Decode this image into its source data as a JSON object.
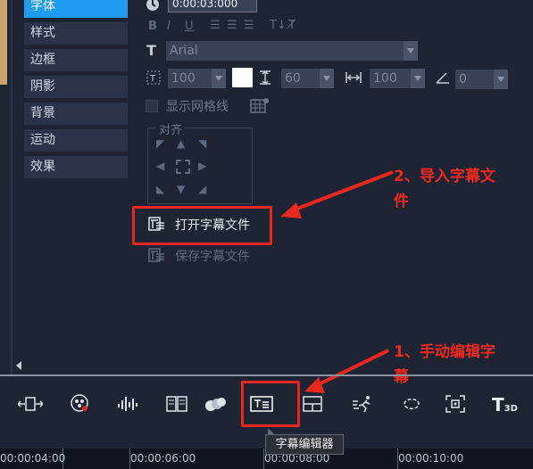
{
  "categories": [
    {
      "label": "字体",
      "active": true
    },
    {
      "label": "样式",
      "active": false
    },
    {
      "label": "边框",
      "active": false
    },
    {
      "label": "阴影",
      "active": false
    },
    {
      "label": "背景",
      "active": false
    },
    {
      "label": "运动",
      "active": false
    },
    {
      "label": "效果",
      "active": false
    }
  ],
  "duration": "0:00:03:000",
  "font": {
    "family": "Arial",
    "size": "100",
    "line_spacing": "60",
    "char_spacing": "100",
    "rotation": "0"
  },
  "show_grid_label": "显示网格线",
  "align_label": "对齐",
  "open_subtitle_label": "打开字幕文件",
  "save_subtitle_label": "保存字幕文件",
  "annotation_import": [
    "2、导入字幕文",
    "件"
  ],
  "annotation_manual": [
    "1、手动编辑字",
    "幕"
  ],
  "tooltip": "字幕编辑器",
  "timeline": [
    "00:00:04:00",
    "00:00:06:00",
    "00:00:08:00",
    "00:00:10:00"
  ],
  "colors": {
    "accent": "#1f9bf0",
    "annotation": "#e8271d",
    "background": "#1e2433"
  }
}
